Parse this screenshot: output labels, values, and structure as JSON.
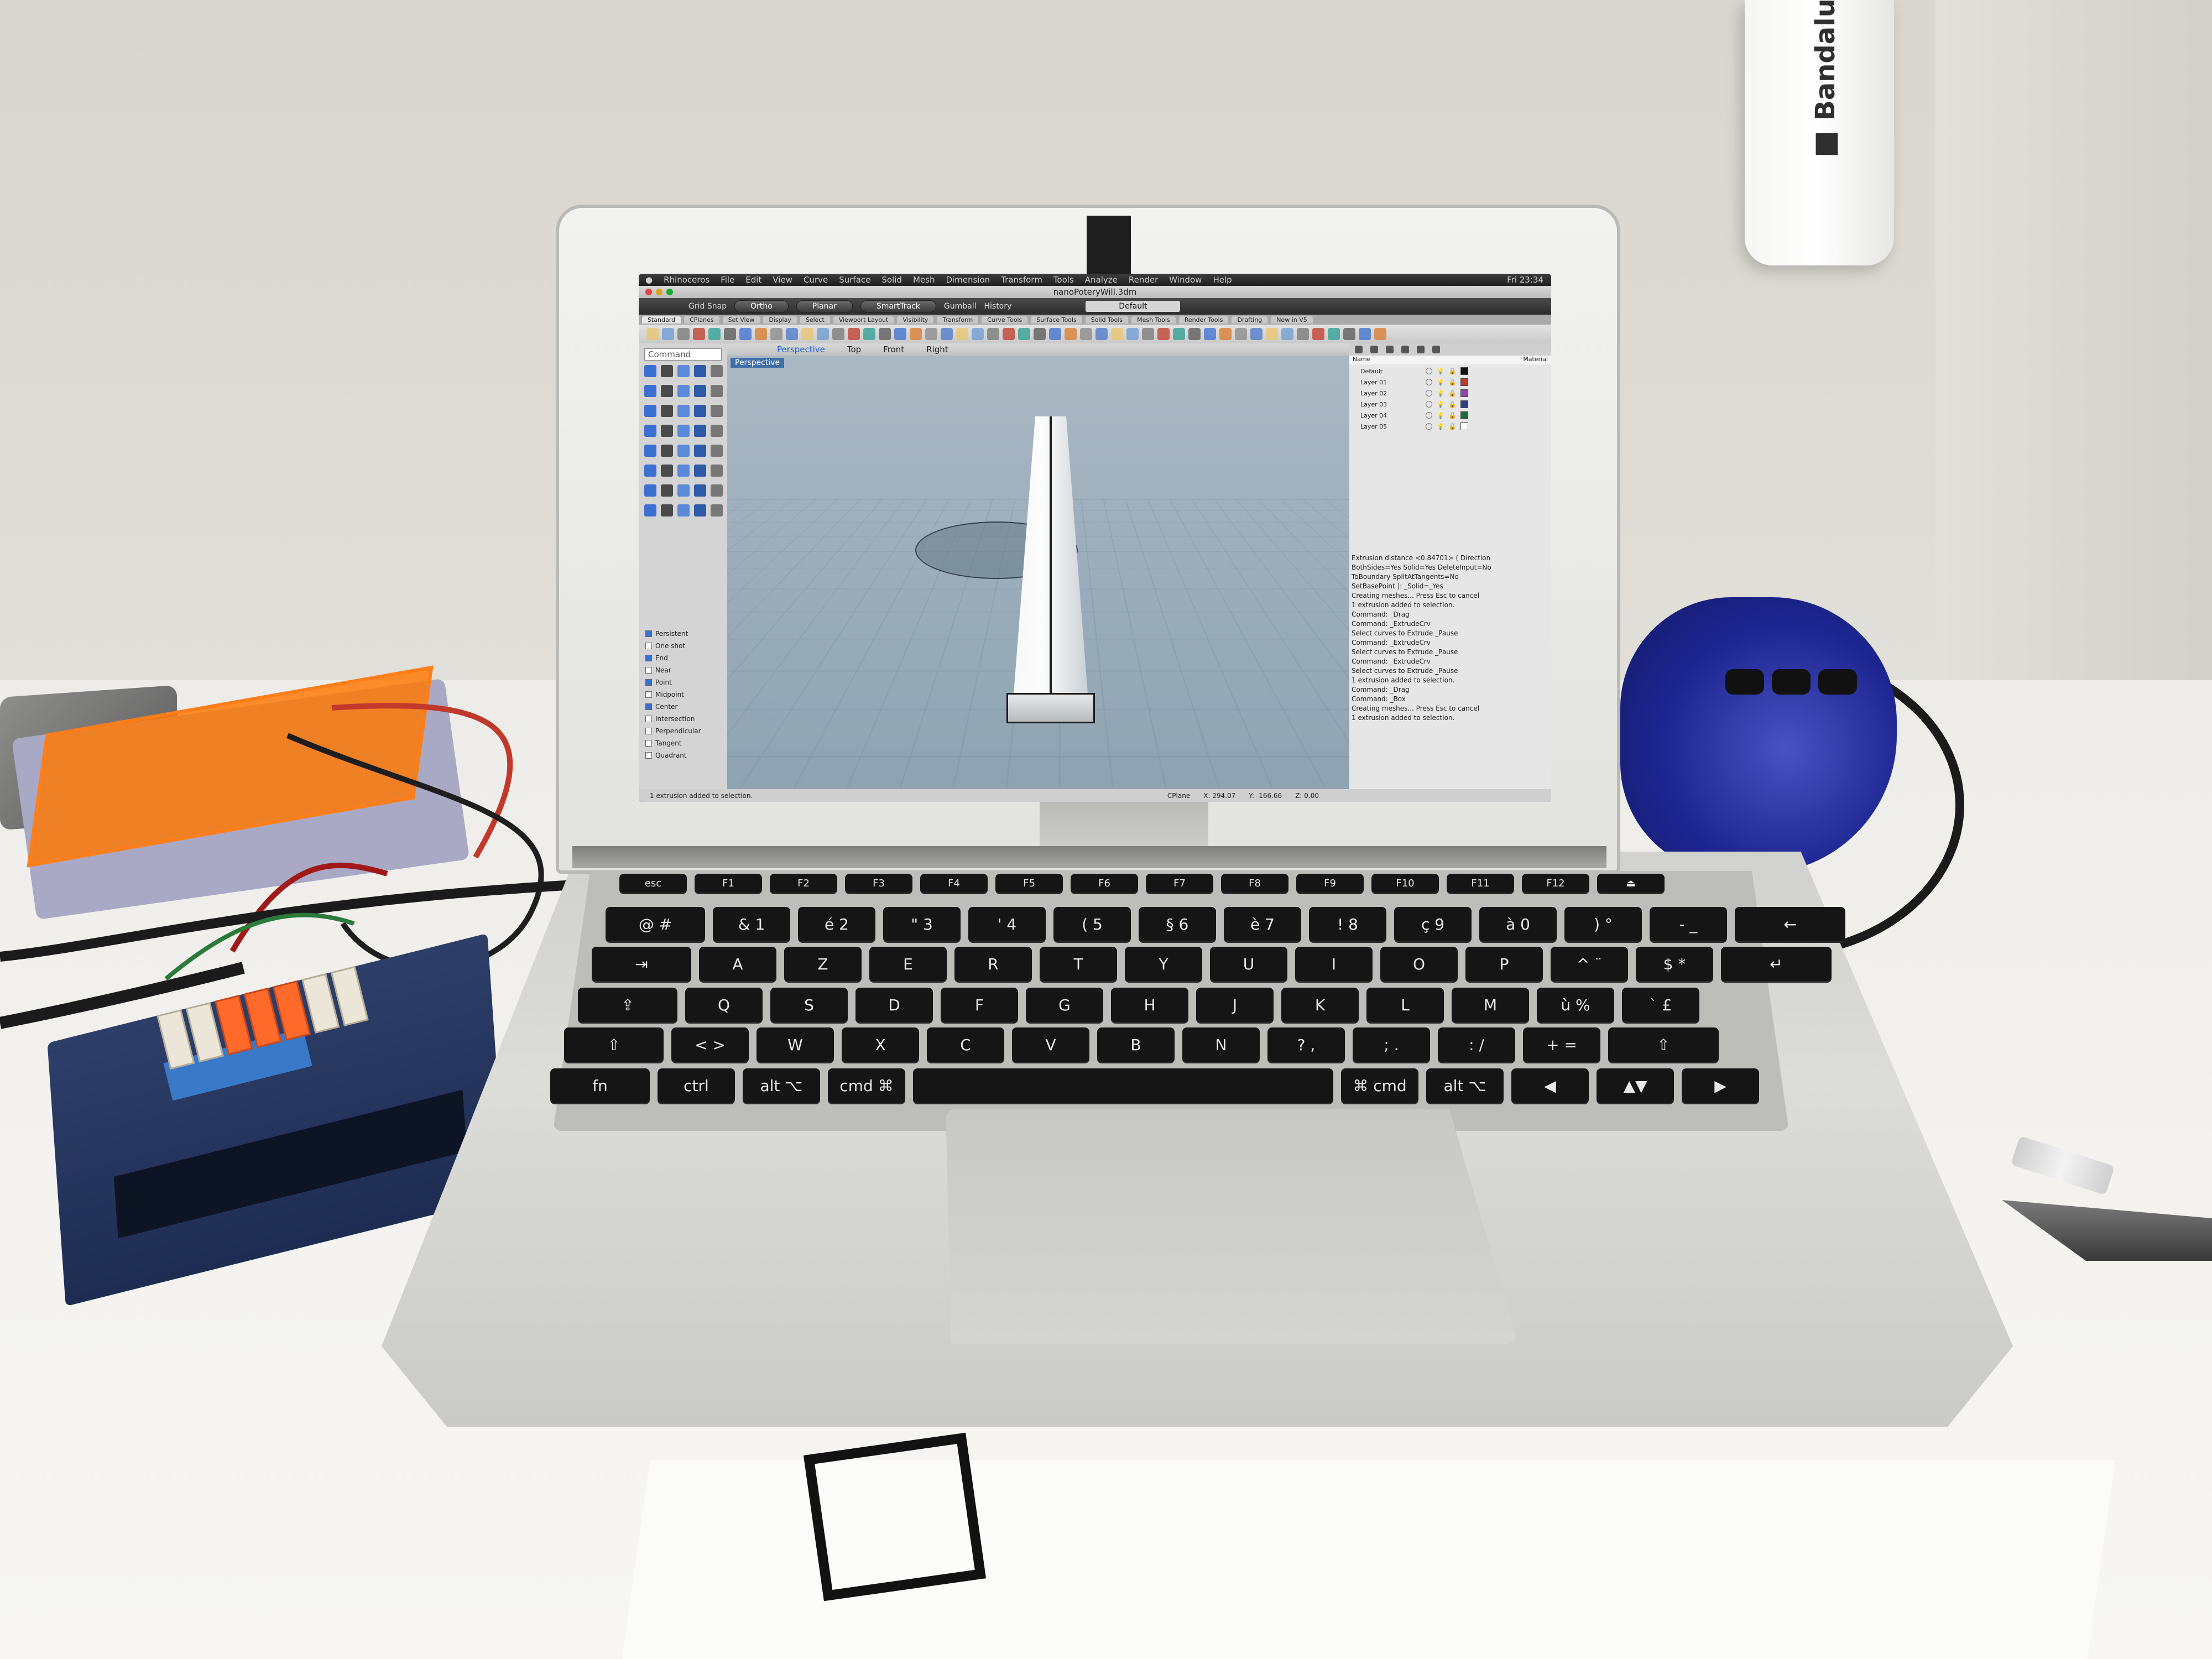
{
  "lamp": {
    "brand": "Bandalux"
  },
  "app": {
    "menu": [
      "Rhinoceros",
      "File",
      "Edit",
      "View",
      "Curve",
      "Surface",
      "Solid",
      "Mesh",
      "Dimension",
      "Transform",
      "Tools",
      "Analyze",
      "Render",
      "Window",
      "Help"
    ],
    "clock": "Fri 23:34",
    "window_title": "nanoPoteryWill.3dm",
    "modes": {
      "grid_snap": "Grid Snap",
      "ortho": "Ortho",
      "planar": "Planar",
      "smarttrack": "SmartTrack",
      "gumball": "Gumball",
      "history": "History"
    },
    "layer_selector": "Default",
    "toolbar_tabs": [
      "Standard",
      "CPlanes",
      "Set View",
      "Display",
      "Select",
      "Viewport Layout",
      "Visibility",
      "Transform",
      "Curve Tools",
      "Surface Tools",
      "Solid Tools",
      "Mesh Tools",
      "Render Tools",
      "Drafting",
      "New in V5"
    ],
    "viewport_tabs": [
      "Perspective",
      "Top",
      "Front",
      "Right"
    ],
    "viewport_label": "Perspective",
    "command_placeholder": "Command",
    "osnaps": [
      {
        "label": "Persistent",
        "checked": true
      },
      {
        "label": "One shot",
        "checked": false
      },
      {
        "label": "End",
        "checked": true
      },
      {
        "label": "Near",
        "checked": false
      },
      {
        "label": "Point",
        "checked": true
      },
      {
        "label": "Midpoint",
        "checked": false
      },
      {
        "label": "Center",
        "checked": true
      },
      {
        "label": "Intersection",
        "checked": false
      },
      {
        "label": "Perpendicular",
        "checked": false
      },
      {
        "label": "Tangent",
        "checked": false
      },
      {
        "label": "Quadrant",
        "checked": false
      }
    ],
    "layers_header": {
      "name": "Name",
      "material": "Material"
    },
    "layers": [
      {
        "name": "Default",
        "color": "#111111"
      },
      {
        "name": "Layer 01",
        "color": "#c0392b"
      },
      {
        "name": "Layer 02",
        "color": "#8e44ad"
      },
      {
        "name": "Layer 03",
        "color": "#2c3e90"
      },
      {
        "name": "Layer 04",
        "color": "#1e6b3a"
      },
      {
        "name": "Layer 05",
        "color": "#ffffff"
      }
    ],
    "command_history": [
      "Extrusion distance <0.84701> ( Direction",
      "BothSides=Yes Solid=Yes DeleteInput=No",
      "ToBoundary SplitAtTangents=No",
      "SetBasePoint ): _Solid=_Yes",
      "Creating meshes... Press Esc to cancel",
      "1 extrusion added to selection.",
      "Command: _Drag",
      "Command: _ExtrudeCrv",
      "Select curves to Extrude _Pause",
      "Command: _ExtrudeCrv",
      "Select curves to Extrude _Pause",
      "Command: _ExtrudeCrv",
      "Select curves to Extrude _Pause",
      "1 extrusion added to selection.",
      "Command: _Drag",
      "Command: _Box",
      "Creating meshes... Press Esc to cancel",
      "1 extrusion added to selection."
    ],
    "status": {
      "message": "1 extrusion added to selection.",
      "cplane": "CPlane",
      "x": "X: 294.07",
      "y": "Y: -166.66",
      "z": "Z: 0.00"
    }
  },
  "keyboard": {
    "rows": [
      [
        "esc",
        "F1",
        "F2",
        "F3",
        "F4",
        "F5",
        "F6",
        "F7",
        "F8",
        "F9",
        "F10",
        "F11",
        "F12",
        "⏏"
      ],
      [
        "@ #",
        "& 1",
        "é 2",
        "\" 3",
        "' 4",
        "( 5",
        "§ 6",
        "è 7",
        "! 8",
        "ç 9",
        "à 0",
        ") °",
        "- _",
        "←"
      ],
      [
        "⇥",
        "A",
        "Z",
        "E",
        "R",
        "T",
        "Y",
        "U",
        "I",
        "O",
        "P",
        "^ ¨",
        "$ *",
        "↵"
      ],
      [
        "⇪",
        "Q",
        "S",
        "D",
        "F",
        "G",
        "H",
        "J",
        "K",
        "L",
        "M",
        "ù %",
        "` £"
      ],
      [
        "⇧",
        "< >",
        "W",
        "X",
        "C",
        "V",
        "B",
        "N",
        "? ,",
        "; .",
        ": /",
        "+ =",
        "⇧"
      ],
      [
        "fn",
        "ctrl",
        "alt ⌥",
        "cmd ⌘",
        "",
        "⌘ cmd",
        "alt ⌥",
        "◀",
        "▲▼",
        "▶"
      ]
    ]
  },
  "colors": {
    "rhino_blue": "#3f6fa8",
    "gamepad": "#1d2591",
    "orange_lid": "#ff7e1a"
  }
}
